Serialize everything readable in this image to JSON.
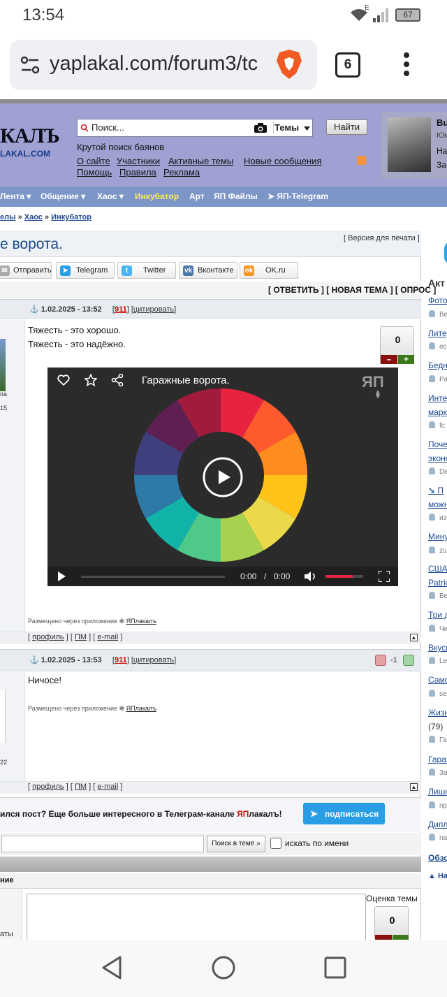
{
  "status_bar": {
    "time": "13:54",
    "network": "E",
    "battery": "67"
  },
  "browser": {
    "url": "yaplakal.com/forum3/tc",
    "tab_count": "6"
  },
  "header": {
    "logo_top": "КАЛЪ",
    "logo_bottom": "LAKAL.COM",
    "search_placeholder": "Поиск...",
    "search_scope": "Темы",
    "search_button": "Найти",
    "tagline": "Крутой поиск баянов",
    "links": [
      "О сайте",
      "Участники",
      "Активные темы",
      "Новые сообщения",
      "Помощь",
      "Правила",
      "Реклама"
    ],
    "user_initial": "Bu",
    "user_line2": "Юм",
    "user_line3": "На",
    "user_line4": "За"
  },
  "nav": {
    "items": [
      "Лента",
      "Общение",
      "Хаос",
      "Инкубатор",
      "Арт",
      "ЯП Файлы",
      "ЯП-Telegram"
    ]
  },
  "breadcrumb": {
    "part1": "елы",
    "sep": "»",
    "part2": "Хаос",
    "part3": "Инкубатор"
  },
  "topic": {
    "title": "е ворота.",
    "print_link": "[ Версия для печати ]",
    "share": [
      "Отправить",
      "Telegram",
      "Twitter",
      "Вконтакте",
      "OK.ru"
    ],
    "actions": "[ ОТВЕТИТЬ ] [ НОВАЯ ТЕМА ] [ ОПРОС ]"
  },
  "posts": [
    {
      "date": "1.02.2025 - 13:52",
      "number": "911",
      "quote": "цитировать",
      "lines": [
        "Тяжесть - это хорошо.",
        "Тяжесть - это надёжно."
      ],
      "rating": "0",
      "video_title": "Гаражные ворота.",
      "video_time_current": "0:00",
      "video_time_sep": "/",
      "video_time_total": "0:00",
      "via_text": "Размещено через приложение",
      "via_app": "ЯПлакалъ",
      "left_frag": "па",
      "left_num": "15"
    },
    {
      "date": "1.02.2025 - 13:53",
      "number": "911",
      "quote": "цитировать",
      "lines": [
        "Ничосе!"
      ],
      "rating": "-1",
      "via_text": "Размещено через приложение",
      "via_app": "ЯПлакалъ",
      "left_num": "22"
    }
  ],
  "post_foot": {
    "profile": "профиль",
    "pm": "ПМ",
    "email": "e-mail"
  },
  "telegram": {
    "text_start": "ился пост? Еще больше интересного в Телеграм-канале ",
    "brand_red": "ЯП",
    "brand_rest": "лакалъ!",
    "button": "подписаться"
  },
  "topic_search": {
    "button": "Поиск в теме »",
    "checkbox_label": "искать по имени"
  },
  "reply": {
    "head": "ние",
    "left_frag": "аты",
    "rating_label": "Оценка темы",
    "rating": "0"
  },
  "sidebar": {
    "title": "Акт",
    "items": [
      {
        "link": "Фото",
        "user": "Be"
      },
      {
        "link": "Литер",
        "user": "ec"
      },
      {
        "link": "Бедн",
        "user": "Pa"
      },
      {
        "link": "Интер",
        "link2": "марк",
        "user": "fc"
      },
      {
        "link": "Почем",
        "link2": "эконо",
        "user": "De"
      },
      {
        "link": "П",
        "link2": "можн",
        "user": "из"
      },
      {
        "link": "Мину",
        "user": "zu"
      },
      {
        "link": "США",
        "link2": "Patric",
        "user": "Be"
      },
      {
        "link": "Три д",
        "user": "Чи"
      },
      {
        "link": "Вкусн",
        "user": "Le"
      },
      {
        "link": "Само",
        "user": "se"
      },
      {
        "link": "Жизн",
        "link2": "(79)",
        "user": "Га"
      },
      {
        "link": "Гараж",
        "user": "За"
      },
      {
        "link": "Лишн",
        "user": "пр"
      },
      {
        "link": "Дипл",
        "user": "na"
      }
    ],
    "more": "Обзо",
    "next": "▲ Нан"
  }
}
